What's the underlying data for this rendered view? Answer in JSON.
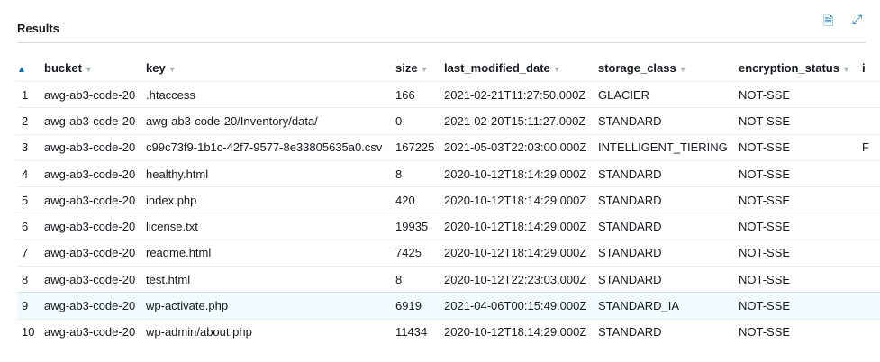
{
  "title": "Results",
  "columns": [
    "bucket",
    "key",
    "size",
    "last_modified_date",
    "storage_class",
    "encryption_status",
    "i"
  ],
  "rows": [
    [
      "1",
      "awg-ab3-code-20",
      ".htaccess",
      "166",
      "2021-02-21T11:27:50.000Z",
      "GLACIER",
      "NOT-SSE",
      ""
    ],
    [
      "2",
      "awg-ab3-code-20",
      "awg-ab3-code-20/Inventory/data/",
      "0",
      "2021-02-20T15:11:27.000Z",
      "STANDARD",
      "NOT-SSE",
      ""
    ],
    [
      "3",
      "awg-ab3-code-20",
      "c99c73f9-1b1c-42f7-9577-8e33805635a0.csv",
      "167225",
      "2021-05-03T22:03:00.000Z",
      "INTELLIGENT_TIERING",
      "NOT-SSE",
      "F"
    ],
    [
      "4",
      "awg-ab3-code-20",
      "healthy.html",
      "8",
      "2020-10-12T18:14:29.000Z",
      "STANDARD",
      "NOT-SSE",
      ""
    ],
    [
      "5",
      "awg-ab3-code-20",
      "index.php",
      "420",
      "2020-10-12T18:14:29.000Z",
      "STANDARD",
      "NOT-SSE",
      ""
    ],
    [
      "6",
      "awg-ab3-code-20",
      "license.txt",
      "19935",
      "2020-10-12T18:14:29.000Z",
      "STANDARD",
      "NOT-SSE",
      ""
    ],
    [
      "7",
      "awg-ab3-code-20",
      "readme.html",
      "7425",
      "2020-10-12T18:14:29.000Z",
      "STANDARD",
      "NOT-SSE",
      ""
    ],
    [
      "8",
      "awg-ab3-code-20",
      "test.html",
      "8",
      "2020-10-12T22:23:03.000Z",
      "STANDARD",
      "NOT-SSE",
      ""
    ],
    [
      "9",
      "awg-ab3-code-20",
      "wp-activate.php",
      "6919",
      "2021-04-06T00:15:49.000Z",
      "STANDARD_IA",
      "NOT-SSE",
      ""
    ],
    [
      "10",
      "awg-ab3-code-20",
      "wp-admin/about.php",
      "11434",
      "2020-10-12T18:14:29.000Z",
      "STANDARD",
      "NOT-SSE",
      ""
    ]
  ],
  "selected_row": 9
}
